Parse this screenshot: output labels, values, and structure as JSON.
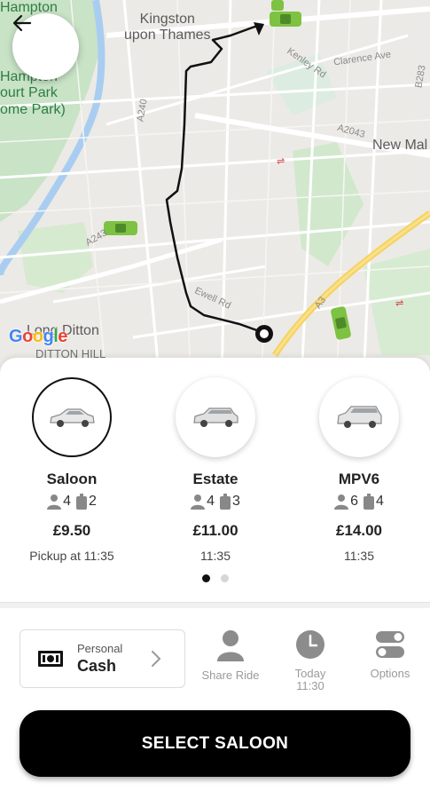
{
  "map": {
    "labels": {
      "kingston_line1": "Kingston",
      "kingston_line2": "upon Thames",
      "hampton_top": "Hampton",
      "hampton_park_1": "Hampton",
      "hampton_park_2": "ourt Park",
      "hampton_park_3": "ome Park)",
      "new_malden": "New Mal",
      "long_ditton": "Long Ditton",
      "ditton_hill": "DITTON HILL",
      "road_a240": "A240",
      "road_a243": "A243",
      "road_a2043": "A2043",
      "road_a3": "A3",
      "road_b283": "B283",
      "road_clarence": "Clarence Ave",
      "road_kenley": "Kenley Rd",
      "road_ewell": "Ewell Rd"
    },
    "google_logo": {
      "letters": [
        "G",
        "o",
        "o",
        "g",
        "l",
        "e"
      ],
      "colors": [
        "#4285F4",
        "#EA4335",
        "#FBBC05",
        "#4285F4",
        "#34A853",
        "#EA4335"
      ]
    },
    "car_color": "#7dc242",
    "route_color": "#111111"
  },
  "vehicles": [
    {
      "name": "Saloon",
      "passengers": "4",
      "luggage": "2",
      "price": "£9.50",
      "eta": "Pickup at 11:35",
      "selected": true
    },
    {
      "name": "Estate",
      "passengers": "4",
      "luggage": "3",
      "price": "£11.00",
      "eta": "11:35",
      "selected": false
    },
    {
      "name": "MPV6",
      "passengers": "6",
      "luggage": "4",
      "price": "£14.00",
      "eta": "11:35",
      "selected": false
    }
  ],
  "pagination": {
    "current": 1,
    "total": 2
  },
  "payment": {
    "type": "Personal",
    "method": "Cash"
  },
  "options": {
    "share_ride": "Share Ride",
    "time_line1": "Today",
    "time_line2": "11:30",
    "options": "Options"
  },
  "select_button": "SELECT SALOON"
}
